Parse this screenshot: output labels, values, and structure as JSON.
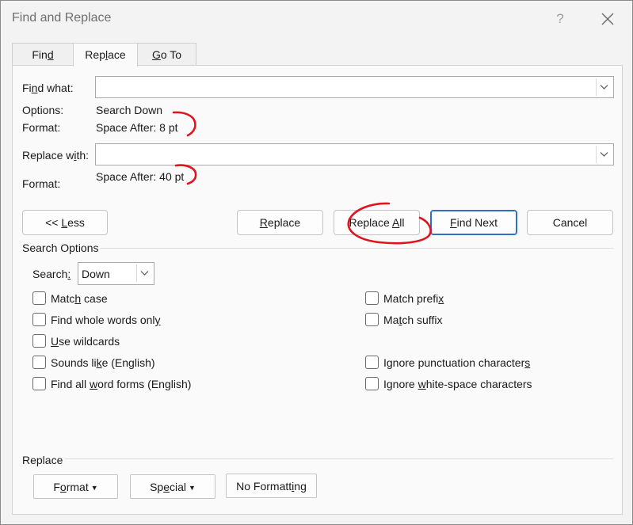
{
  "window": {
    "title": "Find and Replace",
    "help_label": "?"
  },
  "tabs": [
    {
      "pre": "Fin",
      "key": "d",
      "post": ""
    },
    {
      "pre": "Rep",
      "key": "l",
      "post": "ace"
    },
    {
      "pre": "",
      "key": "G",
      "post": "o To"
    }
  ],
  "find": {
    "label_pre": "Fi",
    "label_key": "n",
    "label_post": "d what:",
    "value": "",
    "options_label": "Options:",
    "options_value": "Search Down",
    "format_label": "Format:",
    "format_value": "Space After:  8 pt"
  },
  "replace": {
    "label_pre": "Replace w",
    "label_key": "i",
    "label_post": "th:",
    "value": "",
    "format_label": "Format:",
    "format_value": "Space After:  40 pt"
  },
  "buttons": {
    "less_pre": "<< ",
    "less_key": "L",
    "less_post": "ess",
    "replace_key": "R",
    "replace_post": "eplace",
    "replace_all_pre": "Replace ",
    "replace_all_key": "A",
    "replace_all_post": "ll",
    "find_next_key": "F",
    "find_next_post": "ind Next",
    "cancel": "Cancel"
  },
  "search_options": {
    "heading": "Search Options",
    "search_label_pre": "Search",
    "search_label_key": ":",
    "search_value": "Down",
    "left": [
      {
        "pre": "Matc",
        "key": "h",
        "post": " case",
        "checked": false
      },
      {
        "pre": "Find whole words onl",
        "key": "y",
        "post": "",
        "checked": false
      },
      {
        "pre": "",
        "key": "U",
        "post": "se wildcards",
        "checked": false
      },
      {
        "pre": "Sounds li",
        "key": "k",
        "post": "e (English)",
        "checked": false
      },
      {
        "pre": "Find all ",
        "key": "w",
        "post": "ord forms (English)",
        "checked": false
      }
    ],
    "right": [
      {
        "pre": "Match prefi",
        "key": "x",
        "post": "",
        "checked": false
      },
      {
        "pre": "Ma",
        "key": "t",
        "post": "ch suffix",
        "checked": false
      },
      {
        "pre": "Ignore punctuation character",
        "key": "s",
        "post": "",
        "checked": false
      },
      {
        "pre": "Ignore ",
        "key": "w",
        "post": "hite-space characters",
        "checked": false
      }
    ]
  },
  "replace_section": {
    "heading": "Replace",
    "format_pre": "F",
    "format_key": "o",
    "format_post": "rmat",
    "special_pre": "Sp",
    "special_key": "e",
    "special_post": "cial",
    "no_formatting_pre": "No Formatt",
    "no_formatting_key": "i",
    "no_formatting_post": "ng"
  },
  "colors": {
    "annotation": "#e0141e",
    "default_button_border": "#2d6fc4"
  }
}
